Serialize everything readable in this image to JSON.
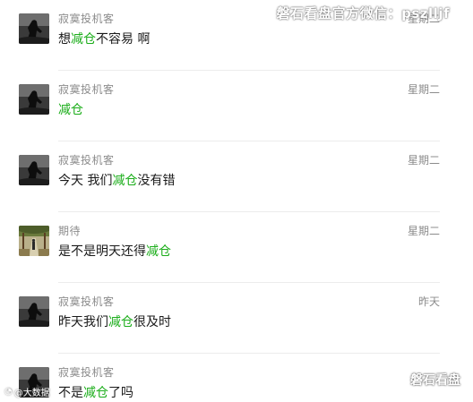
{
  "messages": [
    {
      "name": "寂寞投机客",
      "time": "星期二",
      "parts": [
        "想",
        "减仓",
        "不容易 啊"
      ],
      "avatar": "dark-silhouette-avatar"
    },
    {
      "name": "寂寞投机客",
      "time": "星期二",
      "parts": [
        "",
        "减仓",
        ""
      ],
      "avatar": "dark-silhouette-avatar"
    },
    {
      "name": "寂寞投机客",
      "time": "星期二",
      "parts": [
        "今天 我们",
        "减仓",
        "没有错"
      ],
      "avatar": "dark-silhouette-avatar"
    },
    {
      "name": "期待",
      "time": "星期二",
      "parts": [
        "是不是明天还得",
        "减仓",
        ""
      ],
      "avatar": "garden-path-avatar"
    },
    {
      "name": "寂寞投机客",
      "time": "昨天",
      "parts": [
        "昨天我们",
        "减仓",
        "很及时"
      ],
      "avatar": "dark-silhouette-avatar"
    },
    {
      "name": "寂寞投机客",
      "time": "",
      "parts": [
        "不是",
        "减仓",
        "了吗"
      ],
      "avatar": "dark-silhouette-avatar"
    }
  ],
  "watermarks": {
    "top": "磐石看盘官方微信：pszlljf",
    "bottom_left": "@大数据",
    "bottom_right": "磐石看盘"
  },
  "colors": {
    "highlight": "#1aad19",
    "meta_text": "#8c8c8c",
    "message_text": "#1a1a1a",
    "divider": "#ececec"
  }
}
